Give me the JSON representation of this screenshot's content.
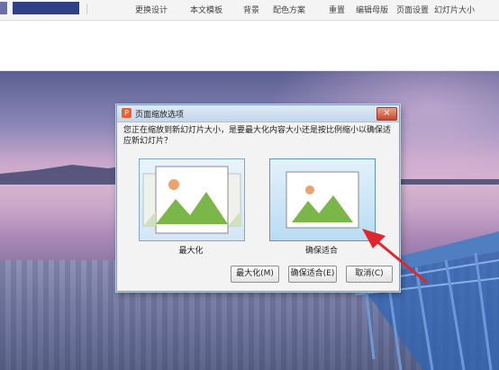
{
  "ribbon": {
    "items": [
      "更换设计",
      "本文模板",
      "背景",
      "配色方案",
      "重置",
      "编辑母版",
      "页面设置",
      "幻灯片大小"
    ]
  },
  "dialog": {
    "title": "页面缩放选项",
    "close_label": "×",
    "prompt": "您正在缩放到新幻灯片大小，是要最大化内容大小还是按比例缩小以确保适应新幻灯片？",
    "options": [
      {
        "label": "最大化"
      },
      {
        "label": "确保适合"
      }
    ],
    "buttons": {
      "maximize": "最大化(M)",
      "ensure_fit": "确保适合(E)",
      "cancel": "取消(C)"
    }
  },
  "colors": {
    "accent": "#e8622f",
    "arrow": "#e0262b",
    "mountain_green": "#7ab648",
    "sun_orange": "#f0a06b"
  }
}
